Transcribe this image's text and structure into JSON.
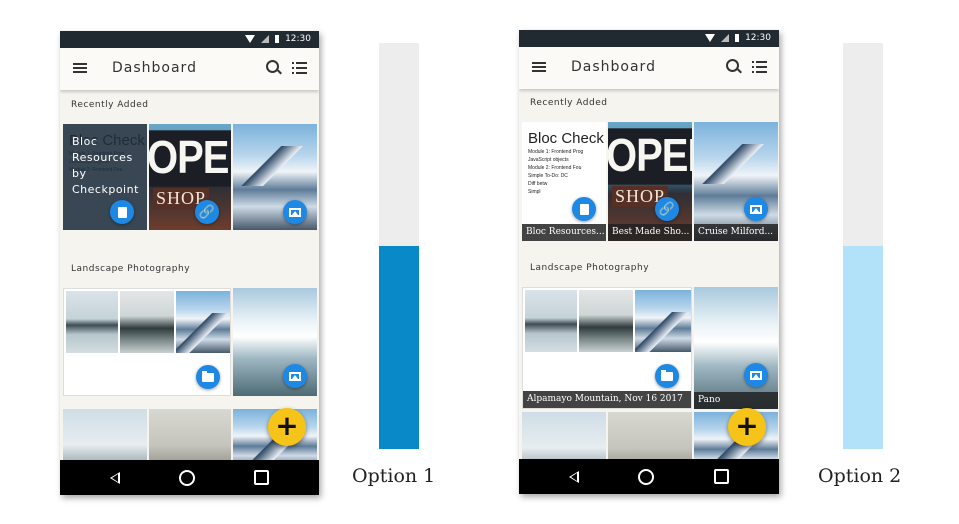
{
  "colors": {
    "option1_bar": "#0a89c9",
    "option2_bar": "#b2e2f9",
    "bar_track": "#ededed",
    "fab": "#f6c418",
    "badge": "#1e88e5",
    "statusbar": "#222a31"
  },
  "statusbar": {
    "time": "12:30"
  },
  "appbar": {
    "title": "Dashboard"
  },
  "sections": {
    "recent": "Recently Added",
    "landscape": "Landscape Photography"
  },
  "doc_preview": {
    "heading": "Bloc Check",
    "lines": [
      "Module 1: Frontend Prog",
      "JavaScript objects",
      "Module 2: Frontend Fou",
      "Simple To-Do: DC",
      "Diff         betw",
      "Simpl"
    ]
  },
  "open_sign": {
    "big": "OPEN",
    "small": "SHOP"
  },
  "option1": {
    "label": "Option 1",
    "overlay_text": "Bloc Resources by Checkpoint",
    "fill_fraction": 0.5
  },
  "option2": {
    "label": "Option 2",
    "captions": [
      "Bloc Resources...",
      "Best Made Sho...",
      "Cruise Milford..."
    ],
    "folder_caption": "Alpamayo Mountain, Nov 16 2017",
    "pano_caption": "Pano",
    "fill_fraction": 0.5
  },
  "icons": {
    "menu": "menu-icon",
    "search": "search-icon",
    "list": "list-icon",
    "doc": "document-icon",
    "link": "link-icon",
    "image": "image-icon",
    "folder": "folder-icon",
    "add": "plus-icon",
    "fab_symbol": "+"
  }
}
